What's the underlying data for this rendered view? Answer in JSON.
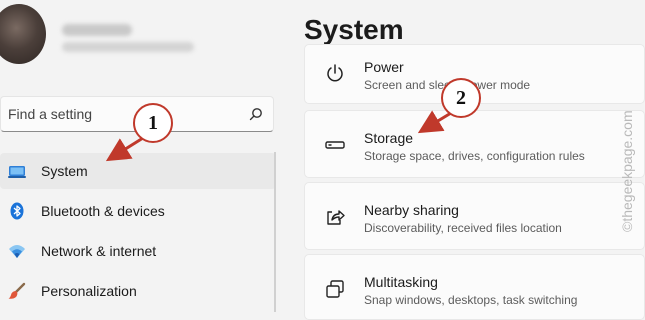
{
  "search": {
    "placeholder": "Find a setting"
  },
  "sidebar": {
    "items": [
      {
        "label": "System",
        "icon": "laptop-icon",
        "active": true
      },
      {
        "label": "Bluetooth & devices",
        "icon": "bluetooth-icon"
      },
      {
        "label": "Network & internet",
        "icon": "wifi-icon"
      },
      {
        "label": "Personalization",
        "icon": "brush-icon"
      }
    ]
  },
  "main": {
    "title": "System",
    "cards": [
      {
        "title": "Power",
        "subtitle": "Screen and sleep, power mode",
        "icon": "power-icon"
      },
      {
        "title": "Storage",
        "subtitle": "Storage space, drives, configuration rules",
        "icon": "storage-icon"
      },
      {
        "title": "Nearby sharing",
        "subtitle": "Discoverability, received files location",
        "icon": "share-icon"
      },
      {
        "title": "Multitasking",
        "subtitle": "Snap windows, desktops, task switching",
        "icon": "multitasking-icon"
      }
    ]
  },
  "annotations": {
    "step1": "1",
    "step2": "2",
    "color": "#c0392b"
  },
  "watermark": "©thegeekpage.com"
}
